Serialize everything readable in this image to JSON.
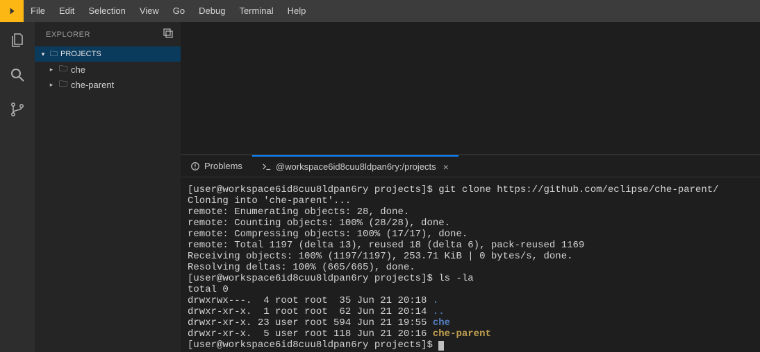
{
  "menu": {
    "items": [
      "File",
      "Edit",
      "Selection",
      "View",
      "Go",
      "Debug",
      "Terminal",
      "Help"
    ]
  },
  "sidebar": {
    "title": "EXPLORER",
    "root": "PROJECTS",
    "tree": [
      {
        "label": "che"
      },
      {
        "label": "che-parent"
      }
    ]
  },
  "panel": {
    "tabs": {
      "problems": "Problems",
      "terminal": "@workspace6id8cuu8ldpan6ry:/projects"
    }
  },
  "terminal": {
    "l0a": "[user@workspace6id8cuu8ldpan6ry projects]$ git clone https://github.com/eclipse/che-parent/",
    "l1": "Cloning into 'che-parent'...",
    "l2": "remote: Enumerating objects: 28, done.",
    "l3": "remote: Counting objects: 100% (28/28), done.",
    "l4": "remote: Compressing objects: 100% (17/17), done.",
    "l5": "remote: Total 1197 (delta 13), reused 18 (delta 6), pack-reused 1169",
    "l6": "Receiving objects: 100% (1197/1197), 253.71 KiB | 0 bytes/s, done.",
    "l7": "Resolving deltas: 100% (665/665), done.",
    "l8": "[user@workspace6id8cuu8ldpan6ry projects]$ ls -la",
    "l9": "total 0",
    "l10a": "drwxrwx---.  4 root root  35 Jun 21 20:18 ",
    "l10b": ".",
    "l11a": "drwxr-xr-x.  1 root root  62 Jun 21 20:14 ",
    "l11b": "..",
    "l12a": "drwxr-xr-x. 23 user root 594 Jun 21 19:55 ",
    "l12b": "che",
    "l13a": "drwxr-xr-x.  5 user root 118 Jun 21 20:16 ",
    "l13b": "che-parent",
    "l14": "[user@workspace6id8cuu8ldpan6ry projects]$ "
  }
}
